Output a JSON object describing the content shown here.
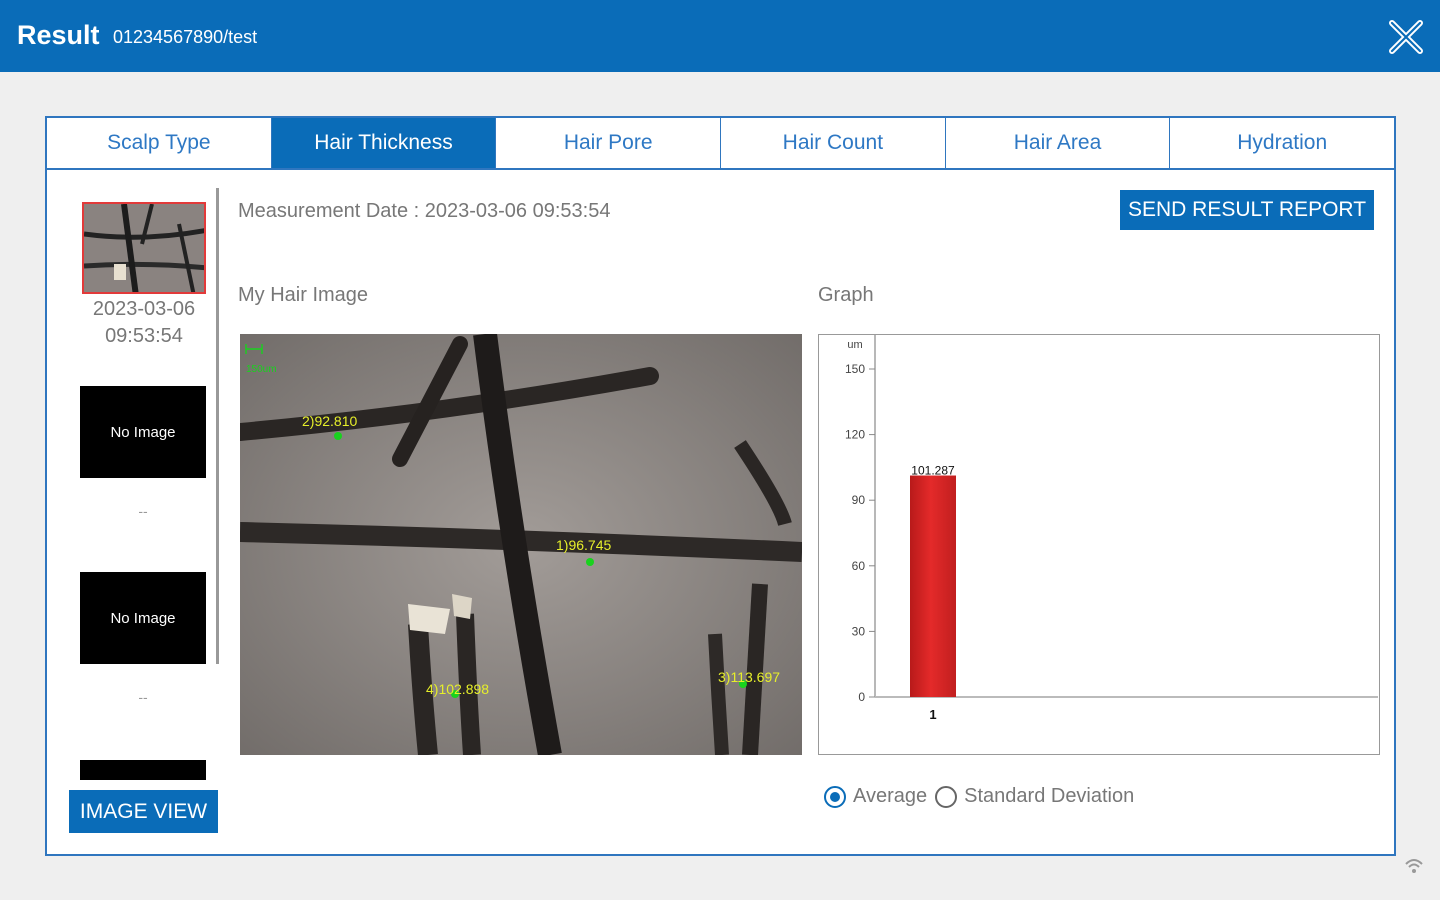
{
  "header": {
    "title": "Result",
    "subtitle": "01234567890/test",
    "close_icon": "close-icon"
  },
  "tabs": [
    {
      "label": "Scalp Type",
      "active": false
    },
    {
      "label": "Hair Thickness",
      "active": true
    },
    {
      "label": "Hair Pore",
      "active": false
    },
    {
      "label": "Hair Count",
      "active": false
    },
    {
      "label": "Hair Area",
      "active": false
    },
    {
      "label": "Hydration",
      "active": false
    }
  ],
  "history": {
    "selected": {
      "date": "2023-03-06",
      "time": "09:53:54"
    },
    "slots": [
      {
        "label": "No Image",
        "caption": "--"
      },
      {
        "label": "No Image",
        "caption": "--"
      }
    ],
    "image_view_button": "IMAGE VIEW"
  },
  "measurement": {
    "date_text": "Measurement Date : 2023-03-06 09:53:54",
    "send_button": "SEND RESULT REPORT"
  },
  "hair_image": {
    "label": "My Hair Image",
    "scale_label": "150um",
    "measurements": [
      {
        "text": "1)96.745"
      },
      {
        "text": "2)92.810"
      },
      {
        "text": "3)113.697"
      },
      {
        "text": "4)102.898"
      }
    ]
  },
  "graph": {
    "label": "Graph",
    "options": [
      {
        "label": "Average",
        "selected": true
      },
      {
        "label": "Standard Deviation",
        "selected": false
      }
    ]
  },
  "chart_data": {
    "type": "bar",
    "categories": [
      "1"
    ],
    "values": [
      101.287
    ],
    "value_labels": [
      "101.287"
    ],
    "ylabel": "um",
    "ylim": [
      0,
      150
    ],
    "yticks": [
      0,
      30,
      60,
      90,
      120,
      150
    ],
    "bar_color": "#e42a2a",
    "grid": false
  },
  "colors": {
    "accent": "#0a6cb8",
    "selected_border": "#e23a3a",
    "measure_text": "#e6ef2a",
    "measure_point": "#19d21e"
  }
}
